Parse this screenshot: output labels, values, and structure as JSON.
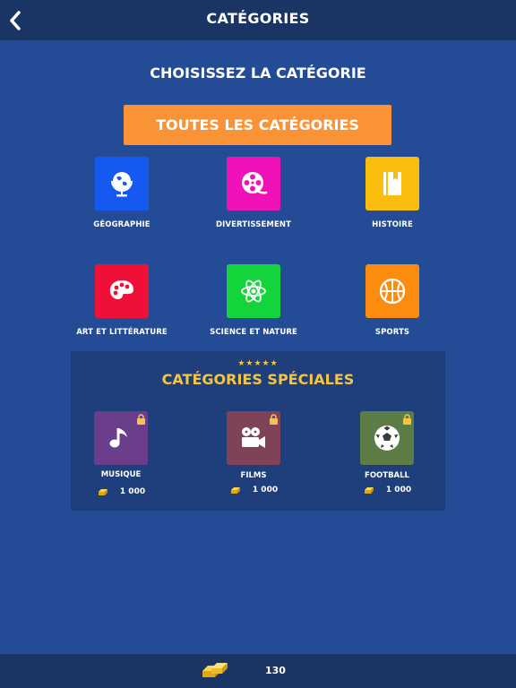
{
  "header": {
    "title": "CATÉGORIES",
    "back_icon": "chevron-left-icon"
  },
  "main": {
    "subtitle": "CHOISISSEZ LA CATÉGORIE",
    "all_button_label": "TOUTES LES CATÉGORIES",
    "categories": [
      {
        "label": "GÉOGRAPHIE",
        "icon": "globe-icon",
        "color": "#1559f0"
      },
      {
        "label": "DIVERTISSEMENT",
        "icon": "film-reel-icon",
        "color": "#f012b9"
      },
      {
        "label": "HISTOIRE",
        "icon": "book-icon",
        "color": "#fbbe0f"
      },
      {
        "label": "ART ET LITTÉRATURE",
        "icon": "palette-icon",
        "color": "#f00f36"
      },
      {
        "label": "SCIENCE ET NATURE",
        "icon": "atom-icon",
        "color": "#14d43b"
      },
      {
        "label": "SPORTS",
        "icon": "basketball-icon",
        "color": "#fb8c0f"
      }
    ]
  },
  "special": {
    "stars": "★★★★★",
    "title": "CATÉGORIES SPÉCIALES",
    "items": [
      {
        "label": "MUSIQUE",
        "price": "1 000",
        "icon": "music-note-icon",
        "color": "#6a3e8b",
        "locked": true
      },
      {
        "label": "FILMS",
        "price": "1 000",
        "icon": "movie-camera-icon",
        "color": "#7e4358",
        "locked": true
      },
      {
        "label": "FOOTBALL",
        "price": "1 000",
        "icon": "soccer-ball-icon",
        "color": "#5e7d46",
        "locked": true
      }
    ]
  },
  "footer": {
    "coins": "130",
    "coin_icon": "gold-bars-icon"
  },
  "colors": {
    "background": "#244b95",
    "bar": "#1a3464",
    "accent": "#fa9236",
    "special_title": "#f5c542"
  }
}
